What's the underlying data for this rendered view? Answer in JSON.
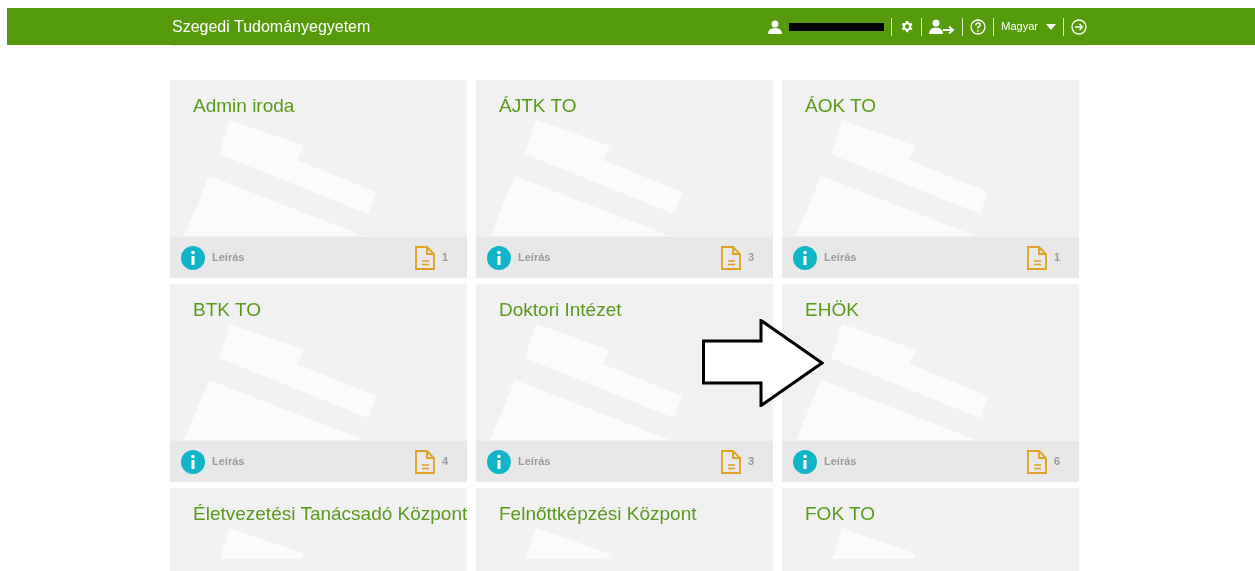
{
  "header": {
    "title": "Szegedi Tudományegyetem",
    "language": "Magyar"
  },
  "cards": [
    {
      "title": "Admin iroda",
      "info_label": "Leírás",
      "count": "1"
    },
    {
      "title": "ÁJTK TO",
      "info_label": "Leírás",
      "count": "3"
    },
    {
      "title": "ÁOK TO",
      "info_label": "Leírás",
      "count": "1"
    },
    {
      "title": "BTK TO",
      "info_label": "Leírás",
      "count": "4"
    },
    {
      "title": "Doktori Intézet",
      "info_label": "Leírás",
      "count": "3"
    },
    {
      "title": "EHÖK",
      "info_label": "Leírás",
      "count": "6"
    },
    {
      "title": "Életvezetési Tanácsadó Központ"
    },
    {
      "title": "Felnőttképzési Központ"
    },
    {
      "title": "FOK TO"
    }
  ]
}
